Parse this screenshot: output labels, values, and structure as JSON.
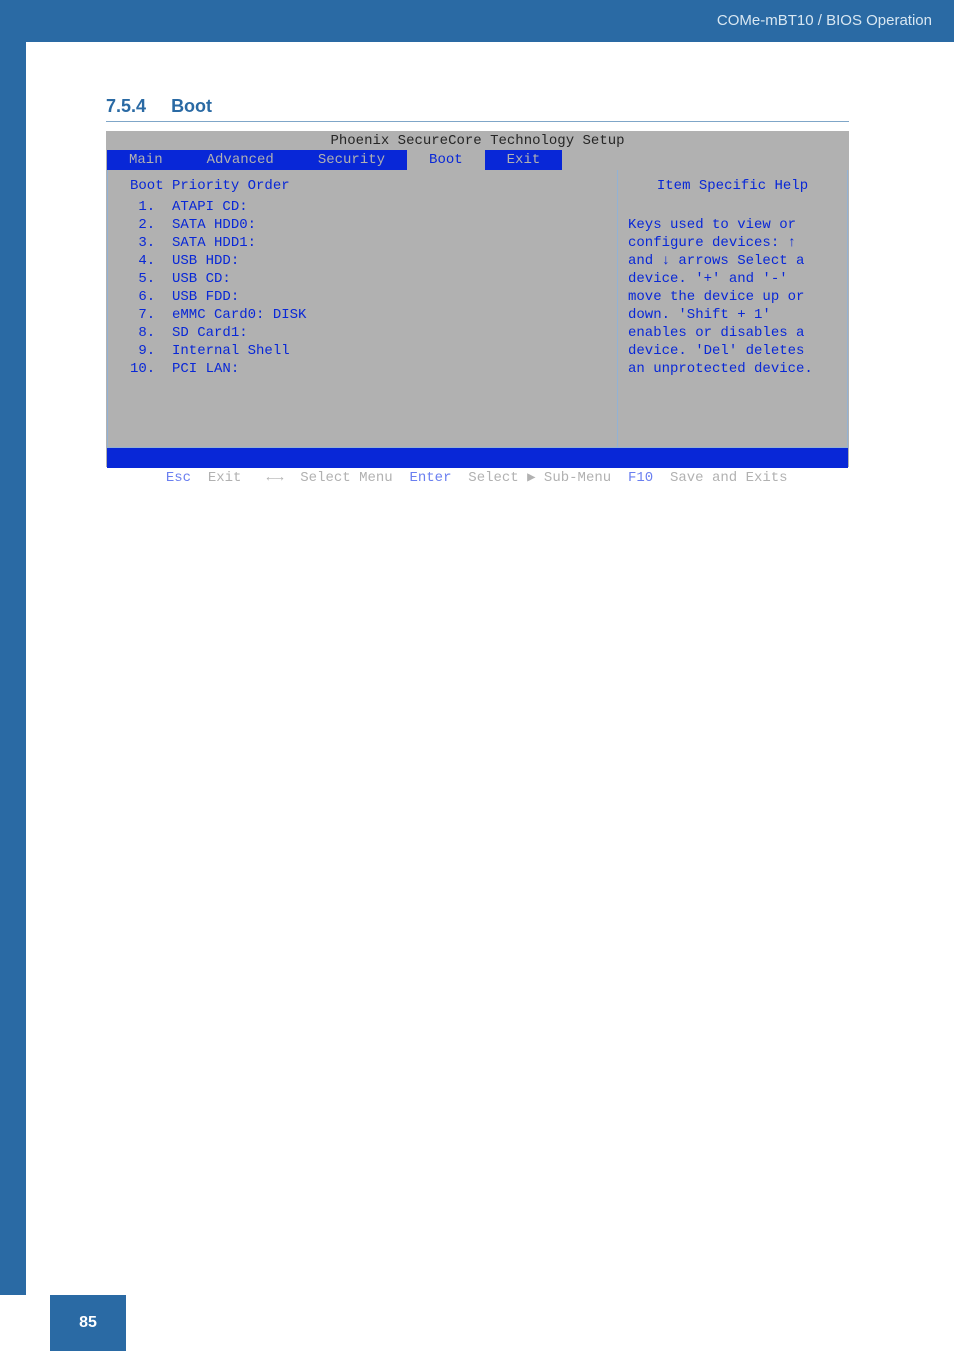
{
  "header": {
    "breadcrumb": "COMe-mBT10 / BIOS Operation"
  },
  "page_number": "85",
  "section": {
    "number": "7.5.4",
    "title": "Boot"
  },
  "bios": {
    "title": "Phoenix SecureCore Technology Setup",
    "tabs": [
      "Main",
      "Advanced",
      "Security",
      "Boot",
      "Exit"
    ],
    "active_tab_index": 3,
    "left": {
      "header": "Boot Priority Order",
      "items": [
        " 1.  ATAPI CD:",
        " 2.  SATA HDD0:",
        " 3.  SATA HDD1:",
        " 4.  USB HDD:",
        " 5.  USB CD:",
        " 6.  USB FDD:",
        " 7.  eMMC Card0: DISK",
        " 8.  SD Card1:",
        " 9.  Internal Shell",
        "10.  PCI LAN:"
      ]
    },
    "right": {
      "title": "Item Specific Help",
      "body_lines": [
        "Keys used to view or",
        "configure devices: ↑",
        "and ↓ arrows Select a",
        "device. '+' and '-'",
        "move the device up or",
        "down. 'Shift + 1'",
        "enables or disables a",
        "device. 'Del' deletes",
        "an unprotected device."
      ]
    },
    "footer": {
      "segments": [
        {
          "cls": "ft-key",
          "text": " Esc "
        },
        {
          "cls": "ft-act",
          "text": " Exit   ←→ "
        },
        {
          "cls": "ft-act",
          "text": " Select Menu "
        },
        {
          "cls": "ft-key",
          "text": " Enter "
        },
        {
          "cls": "ft-act",
          "text": " Select ▶ Sub-Menu "
        },
        {
          "cls": "ft-key",
          "text": " F10 "
        },
        {
          "cls": "ft-act",
          "text": " Save and Exits "
        }
      ]
    }
  }
}
